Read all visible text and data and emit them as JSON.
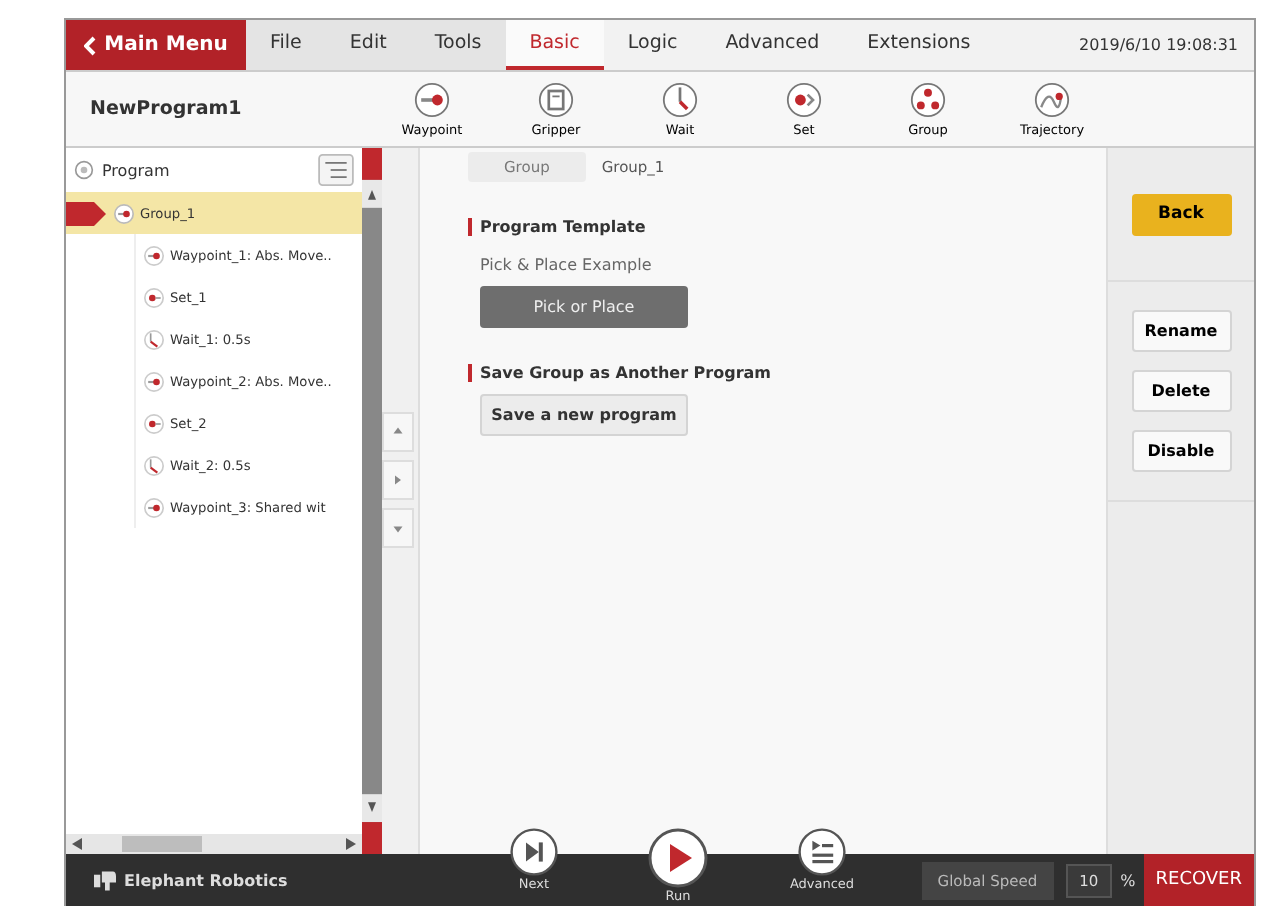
{
  "menu": {
    "back_label": "Main Menu",
    "tabs": [
      {
        "label": "File",
        "kind": "menu",
        "selected": false
      },
      {
        "label": "Edit",
        "kind": "menu",
        "selected": false
      },
      {
        "label": "Tools",
        "kind": "menu",
        "selected": false
      },
      {
        "label": "Basic",
        "kind": "tab",
        "selected": true
      },
      {
        "label": "Logic",
        "kind": "tab",
        "selected": false
      },
      {
        "label": "Advanced",
        "kind": "tab",
        "selected": false
      },
      {
        "label": "Extensions",
        "kind": "tab",
        "selected": false
      }
    ],
    "datetime": "2019/6/10 19:08:31"
  },
  "toolbar": {
    "program_name": "NewProgram1",
    "tools": [
      {
        "label": "Waypoint",
        "kind": "waypoint"
      },
      {
        "label": "Gripper",
        "kind": "gripper"
      },
      {
        "label": "Wait",
        "kind": "wait"
      },
      {
        "label": "Set",
        "kind": "set"
      },
      {
        "label": "Group",
        "kind": "group"
      },
      {
        "label": "Trajectory",
        "kind": "trajectory"
      }
    ]
  },
  "tree": {
    "label": "Program",
    "children": [
      {
        "label": "Group_1",
        "selected": true,
        "children": [
          {
            "label": "Waypoint_1: Abs. Move..",
            "kind": "waypoint",
            "selected": false
          },
          {
            "label": "Set_1",
            "kind": "set",
            "selected": false
          },
          {
            "label": "Wait_1: 0.5s",
            "kind": "wait",
            "selected": false
          },
          {
            "label": "Waypoint_2: Abs. Move..",
            "kind": "waypoint",
            "selected": false
          },
          {
            "label": "Set_2",
            "kind": "set",
            "selected": false
          },
          {
            "label": "Wait_2: 0.5s",
            "kind": "wait",
            "selected": false
          },
          {
            "label": "Waypoint_3: Shared wit",
            "kind": "waypoint",
            "selected": false
          }
        ]
      }
    ]
  },
  "content": {
    "node_type": "Group",
    "node_name": "Group_1",
    "sections": [
      {
        "title": "Program Template",
        "caption": "Pick & Place Example",
        "button": "Pick or Place",
        "kind": "dark"
      },
      {
        "title": "Save Group as Another Program",
        "button": "Save a new program",
        "kind": "light"
      }
    ]
  },
  "actions": {
    "back": "Back",
    "buttons": [
      "Rename",
      "Delete",
      "Disable"
    ]
  },
  "footer": {
    "brand": "Elephant Robotics",
    "controls": [
      {
        "label": "Next",
        "kind": "next"
      },
      {
        "label": "Run",
        "kind": "run"
      },
      {
        "label": "Advanced",
        "kind": "advanced"
      }
    ],
    "speed_label": "Global Speed",
    "speed_value": "10",
    "speed_unit": "%",
    "recover": "RECOVER"
  }
}
